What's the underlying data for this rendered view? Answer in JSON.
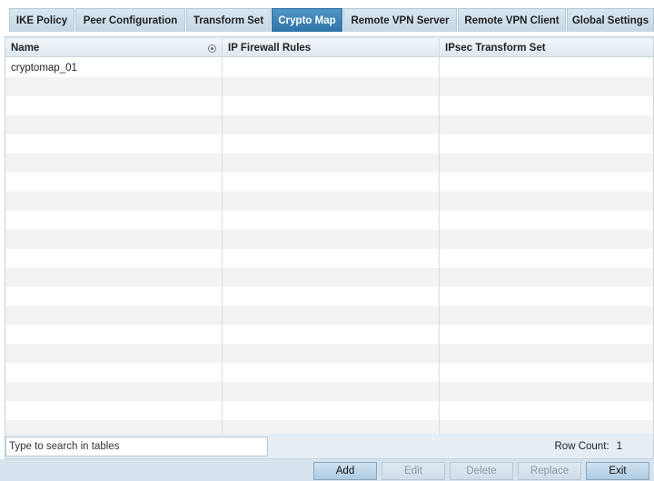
{
  "tabs": [
    {
      "label": "IKE Policy",
      "active": false
    },
    {
      "label": "Peer Configuration",
      "active": false
    },
    {
      "label": "Transform Set",
      "active": false
    },
    {
      "label": "Crypto Map",
      "active": true
    },
    {
      "label": "Remote VPN Server",
      "active": false
    },
    {
      "label": "Remote VPN Client",
      "active": false
    },
    {
      "label": "Global Settings",
      "active": false
    }
  ],
  "table": {
    "columns": [
      "Name",
      "IP Firewall Rules",
      "IPsec Transform Set"
    ],
    "rows": [
      [
        "cryptomap_01",
        "",
        ""
      ]
    ]
  },
  "search": {
    "value": "Type to search in tables"
  },
  "row_count": {
    "label": "Row  Count:",
    "value": "1"
  },
  "buttons": {
    "add": "Add",
    "edit": "Edit",
    "delete": "Delete",
    "replace": "Replace",
    "exit": "Exit"
  },
  "colors": {
    "active_tab": "#3a80b5",
    "tab": "#cfdfeb",
    "panel": "#e6eef5"
  }
}
